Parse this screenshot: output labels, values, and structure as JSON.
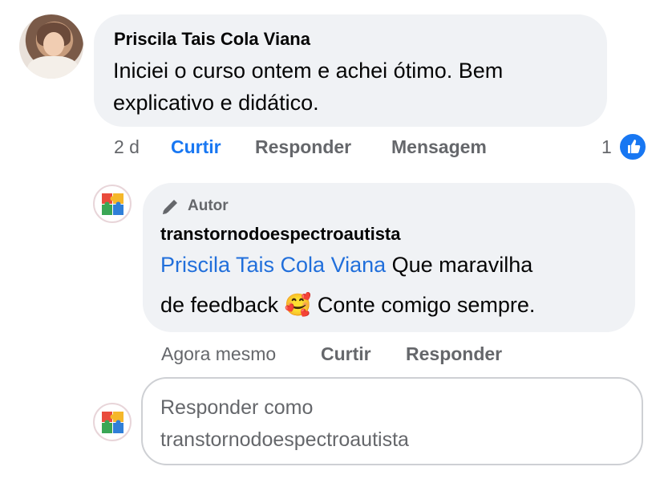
{
  "comment": {
    "author": "Priscila Tais Cola Viana",
    "text": "Iniciei o curso ontem e achei ótimo.  Bem explicativo e didático.",
    "time": "2 d",
    "actions": {
      "like": "Curtir",
      "reply": "Responder",
      "message": "Mensagem"
    },
    "reaction_count": "1",
    "reaction_icon": "like-icon"
  },
  "reply": {
    "badge": "Autor",
    "badge_icon": "pencil-icon",
    "author": "transtornodoespectroautista",
    "mention": "Priscila Tais Cola Viana",
    "text_line1": " Que maravilha",
    "text_line2_before": "de feedback ",
    "emoji": "🥰",
    "text_line2_after": " Conte comigo sempre.",
    "time": "Agora mesmo",
    "actions": {
      "like": "Curtir",
      "reply": "Responder"
    }
  },
  "compose": {
    "placeholder_line1": "Responder como",
    "placeholder_line2": "transtornodoespectroautista"
  },
  "colors": {
    "bubble": "#f0f2f5",
    "link_blue": "#216fdb",
    "action_like": "#1877f2",
    "meta_gray": "#65676b"
  }
}
